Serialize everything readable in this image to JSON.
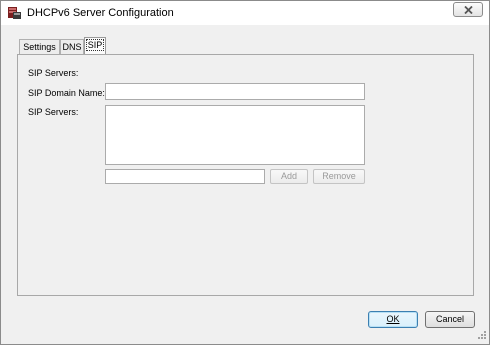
{
  "window": {
    "title": "DHCPv6 Server Configuration"
  },
  "icons": {
    "app": "server-config-icon",
    "close": "close-icon",
    "resize": "resize-grip-icon"
  },
  "tabs": [
    {
      "label": "Settings",
      "active": false
    },
    {
      "label": "DNS",
      "active": false
    },
    {
      "label": "SIP",
      "active": true
    }
  ],
  "sip": {
    "section_heading": "SIP Servers:",
    "domain_label": "SIP Domain Name:",
    "domain_value": "",
    "servers_label": "SIP Servers:",
    "servers_list": [],
    "new_server_value": "",
    "add_label": "Add",
    "remove_label": "Remove"
  },
  "footer": {
    "ok_label": "OK",
    "cancel_label": "Cancel"
  },
  "colors": {
    "window_bg": "#f0f0f0",
    "default_button_border": "#3c7fb1",
    "close_x": "#555555"
  }
}
